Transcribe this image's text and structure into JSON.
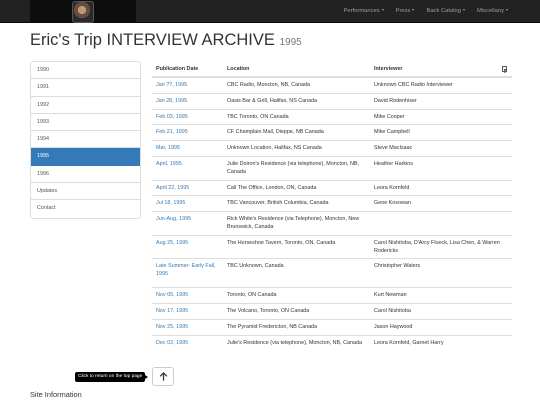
{
  "nav": {
    "items": [
      {
        "label": "Performances"
      },
      {
        "label": "Press"
      },
      {
        "label": "Back Catalog"
      },
      {
        "label": "Miscellany"
      }
    ]
  },
  "page": {
    "title": "Eric's Trip INTERVIEW ARCHIVE",
    "year": "1995"
  },
  "sidebar": {
    "items": [
      {
        "label": "1990",
        "active": false
      },
      {
        "label": "1991",
        "active": false
      },
      {
        "label": "1992",
        "active": false
      },
      {
        "label": "1993",
        "active": false
      },
      {
        "label": "1994",
        "active": false
      },
      {
        "label": "1995",
        "active": true
      },
      {
        "label": "1996",
        "active": false
      },
      {
        "label": "Updates",
        "active": false
      },
      {
        "label": "Contact",
        "active": false
      }
    ]
  },
  "table": {
    "headers": {
      "date": "Publication Date",
      "location": "Location",
      "interviewer": "Interviewer"
    },
    "rows": [
      {
        "date": "Jan ??, 1995",
        "location": "CBC Radio, Moncton, NB, Canada",
        "interviewer": "Unknown CBC Radio Interviewer",
        "h": 1
      },
      {
        "date": "Jan 28, 1995",
        "location": "Oasis Bar & Grill, Halifax, NS Canada",
        "interviewer": "David Rodenhiser",
        "h": 1
      },
      {
        "date": "Feb 03, 1995",
        "location": "TBC Toronto, ON Canada",
        "interviewer": "Mike Cooper",
        "h": 1
      },
      {
        "date": "Feb 21, 1995",
        "location": "CF Champlain Mall, Dieppe, NB Canada",
        "interviewer": "Mike Campbell",
        "h": 1
      },
      {
        "date": "Mar, 1995",
        "location": "Unknown Location, Halifax, NS Canada",
        "interviewer": "Steve MacIsaac",
        "h": 1
      },
      {
        "date": "April, 1995",
        "location": "Julie Doiron's Residence (via telephone), Moncton, NB, Canada",
        "interviewer": "Heather Harkins",
        "h": 2
      },
      {
        "date": "April 22, 1995",
        "location": "Call The Office, London, ON, Canada",
        "interviewer": "Leora Kornfeld",
        "h": 1
      },
      {
        "date": "Jul 18, 1995",
        "location": "TBC Vancouver, British Columbia, Canada",
        "interviewer": "Gene Kosowan",
        "h": 1
      },
      {
        "date": "Jun-Aug, 1995",
        "location": "Rick White's Residence (via Telephone), Moncton, New Brunswick, Canada",
        "interviewer": "",
        "h": 2
      },
      {
        "date": "Aug 25, 1995",
        "location": "The Horseshoe Tavern, Toronto, ON, Canada",
        "interviewer": "Carol Nishitoba, D'Arcy Flueck, Lisa Chen, & Warren Rodericks",
        "h": 2
      },
      {
        "date": "Late Summer- Early Fall, 1995",
        "location": "TBC Unknown, Canada",
        "interviewer": "Christopher Waters",
        "h": 3
      },
      {
        "date": "Nov 05, 1995",
        "location": "Toronto, ON Canada",
        "interviewer": "Kurt Newman",
        "h": 1
      },
      {
        "date": "Nov 17, 1995",
        "location": "The Volcano, Toronto, ON Canada",
        "interviewer": "Carol Nishitoba",
        "h": 1
      },
      {
        "date": "Nov 25, 1995",
        "location": "The Pyramid Fredericton, NB Canada",
        "interviewer": "Jason Haywood",
        "h": 1
      },
      {
        "date": "Dec 02, 1995",
        "location": "Julie's Residence (via telephone), Moncton, NB, Canada",
        "interviewer": "Leora Kornfeld, Garnet Harry",
        "h": 2
      }
    ]
  },
  "back_to_top": {
    "tooltip": "Click to return on the top page"
  },
  "footer": {
    "site_info": "Site Information"
  },
  "colors": {
    "navbar": "#222222",
    "accent": "#337ab7",
    "link": "#337ab7"
  }
}
